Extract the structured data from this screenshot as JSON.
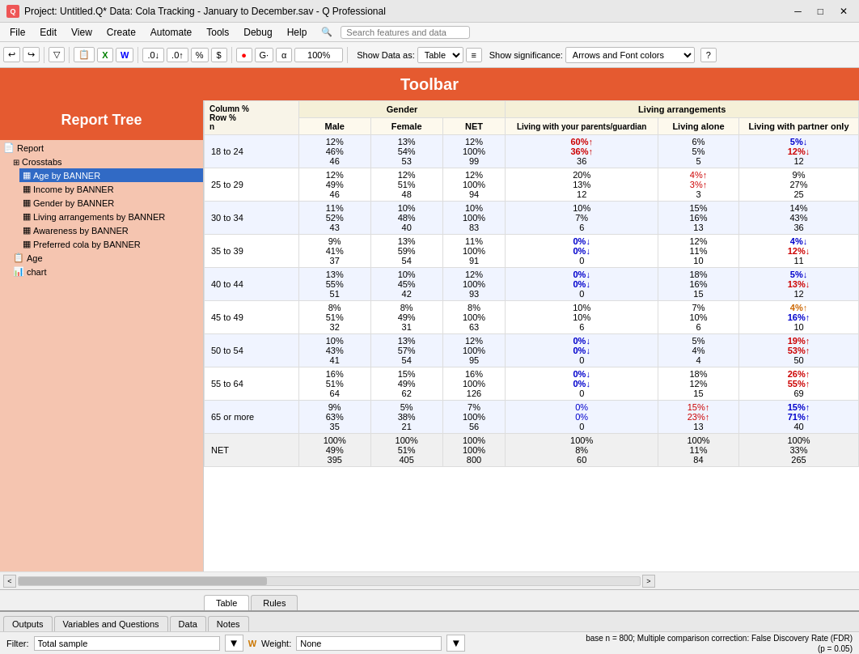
{
  "titleBar": {
    "title": "Project: Untitled.Q* Data: Cola Tracking - January to December.sav - Q Professional"
  },
  "menuBar": {
    "items": [
      "File",
      "Edit",
      "View",
      "Create",
      "Automate",
      "Tools",
      "Debug",
      "Help"
    ],
    "search": {
      "placeholder": "Search features and data"
    }
  },
  "toolbar": {
    "label": "Toolbar",
    "showDataAs": "Show Data as:",
    "tableLabel": "Table",
    "showSignificance": "Show significance:",
    "arrowsLabel": "Arrows and Font colors",
    "zoomLevel": "100%"
  },
  "reportTree": {
    "header": "Report Tree",
    "items": [
      {
        "label": "Report",
        "level": 0,
        "type": "report"
      },
      {
        "label": "Crosstabs",
        "level": 1,
        "type": "crosstabs"
      },
      {
        "label": "Age by BANNER",
        "level": 2,
        "type": "table",
        "selected": true
      },
      {
        "label": "Income by BANNER",
        "level": 2,
        "type": "table"
      },
      {
        "label": "Gender by BANNER",
        "level": 2,
        "type": "table"
      },
      {
        "label": "Living arrangements by BANNER",
        "level": 2,
        "type": "table"
      },
      {
        "label": "Awareness by BANNER",
        "level": 2,
        "type": "table"
      },
      {
        "label": "Preferred cola by BANNER",
        "level": 2,
        "type": "table"
      },
      {
        "label": "Age",
        "level": 1,
        "type": "report"
      },
      {
        "label": "chart",
        "level": 1,
        "type": "chart"
      }
    ]
  },
  "table": {
    "columnHeader1": "Column %",
    "columnHeader2": "Row %",
    "columnHeader3": "n",
    "genderGroup": "Gender",
    "livingGroup": "Living arrangements",
    "colMale": "Male",
    "colFemale": "Female",
    "colNET": "NET",
    "colLivingParents": "Living with your parents/guardian",
    "colLivingAlone": "Living alone",
    "colLivingPartner": "Living with partner only",
    "rows": [
      {
        "label": "18 to 24",
        "male": [
          "12%",
          "46%",
          "46"
        ],
        "female": [
          "13%",
          "54%",
          "53"
        ],
        "net": [
          "12%",
          "100%",
          "99"
        ],
        "parents": [
          "60%↑",
          "36%↑",
          "36"
        ],
        "alone": [
          "6%",
          "5%",
          "5"
        ],
        "partner": [
          "5%↓",
          "12%↓",
          "12"
        ],
        "parentColors": [
          "red-up",
          "red-up",
          ""
        ],
        "partnerColors": [
          "blue-down",
          "red-text",
          ""
        ]
      },
      {
        "label": "25 to 29",
        "male": [
          "12%",
          "49%",
          "46"
        ],
        "female": [
          "12%",
          "51%",
          "48"
        ],
        "net": [
          "12%",
          "100%",
          "94"
        ],
        "parents": [
          "20%",
          "13%",
          "12"
        ],
        "alone": [
          "4%↑",
          "3%↑",
          "3"
        ],
        "partner": [
          "9%",
          "27%",
          "25"
        ],
        "parentColors": [
          "",
          "",
          ""
        ],
        "partnerColors": [
          "",
          "",
          ""
        ]
      },
      {
        "label": "30 to 34",
        "male": [
          "11%",
          "52%",
          "43"
        ],
        "female": [
          "10%",
          "48%",
          "40"
        ],
        "net": [
          "10%",
          "100%",
          "83"
        ],
        "parents": [
          "10%",
          "7%",
          "6"
        ],
        "alone": [
          "15%",
          "16%",
          "13"
        ],
        "partner": [
          "14%",
          "43%",
          "36"
        ],
        "parentColors": [
          "",
          "",
          ""
        ],
        "partnerColors": [
          "",
          "",
          ""
        ]
      },
      {
        "label": "35 to 39",
        "male": [
          "9%",
          "41%",
          "37"
        ],
        "female": [
          "13%",
          "59%",
          "54"
        ],
        "net": [
          "11%",
          "100%",
          "91"
        ],
        "parents": [
          "0%↓",
          "0%↓",
          "0"
        ],
        "alone": [
          "12%",
          "11%",
          "10"
        ],
        "partner": [
          "4%↓",
          "12%↓",
          "11"
        ],
        "parentColors": [
          "blue-down",
          "blue-down",
          ""
        ],
        "partnerColors": [
          "blue-down",
          "red-text",
          ""
        ]
      },
      {
        "label": "40 to 44",
        "male": [
          "13%",
          "55%",
          "51"
        ],
        "female": [
          "10%",
          "45%",
          "42"
        ],
        "net": [
          "12%",
          "100%",
          "93"
        ],
        "parents": [
          "0%↓",
          "0%↓",
          "0"
        ],
        "alone": [
          "18%",
          "16%",
          "15"
        ],
        "partner": [
          "5%↓",
          "13%↓",
          "12"
        ],
        "parentColors": [
          "blue-down",
          "blue-down",
          ""
        ],
        "partnerColors": [
          "blue-down",
          "red-text",
          ""
        ]
      },
      {
        "label": "45 to 49",
        "male": [
          "8%",
          "51%",
          "32"
        ],
        "female": [
          "8%",
          "49%",
          "31"
        ],
        "net": [
          "8%",
          "100%",
          "63"
        ],
        "parents": [
          "10%",
          "10%",
          "6"
        ],
        "alone": [
          "7%",
          "10%",
          "6"
        ],
        "partner": [
          "4%↑",
          "16%↑",
          "10"
        ],
        "parentColors": [
          "",
          "",
          ""
        ],
        "partnerColors": [
          "orange-up",
          "blue-text",
          ""
        ]
      },
      {
        "label": "50 to 54",
        "male": [
          "10%",
          "43%",
          "41"
        ],
        "female": [
          "13%",
          "57%",
          "54"
        ],
        "net": [
          "12%",
          "100%",
          "95"
        ],
        "parents": [
          "0%↓",
          "0%↓",
          "0"
        ],
        "alone": [
          "5%",
          "4%",
          "4"
        ],
        "partner": [
          "19%↑",
          "53%↑",
          "50"
        ],
        "parentColors": [
          "blue-down",
          "blue-down",
          ""
        ],
        "partnerColors": [
          "red-up",
          "red-up",
          ""
        ]
      },
      {
        "label": "55 to 64",
        "male": [
          "16%",
          "51%",
          "64"
        ],
        "female": [
          "15%",
          "49%",
          "62"
        ],
        "net": [
          "16%",
          "100%",
          "126"
        ],
        "parents": [
          "0%↓",
          "0%↓",
          "0"
        ],
        "alone": [
          "18%",
          "12%",
          "15"
        ],
        "partner": [
          "26%↑",
          "55%↑",
          "69"
        ],
        "parentColors": [
          "blue-down",
          "blue-down",
          ""
        ],
        "partnerColors": [
          "red-up",
          "red-up",
          ""
        ]
      },
      {
        "label": "65 or more",
        "male": [
          "9%",
          "63%",
          "35"
        ],
        "female": [
          "5%",
          "38%",
          "21"
        ],
        "net": [
          "7%",
          "100%",
          "56"
        ],
        "parents": [
          "0%",
          "0%",
          "0"
        ],
        "alone": [
          "15%↑",
          "23%↑",
          "13"
        ],
        "partner": [
          "15%↑",
          "71%↑",
          "40"
        ],
        "parentColors": [
          "blue-text",
          "blue-text",
          ""
        ],
        "partnerColors": [
          "blue-text",
          "blue-text",
          ""
        ]
      },
      {
        "label": "NET",
        "male": [
          "100%",
          "49%",
          "395"
        ],
        "female": [
          "100%",
          "51%",
          "405"
        ],
        "net": [
          "100%",
          "100%",
          "800"
        ],
        "parents": [
          "100%",
          "8%",
          "60"
        ],
        "alone": [
          "100%",
          "11%",
          "84"
        ],
        "partner": [
          "100%",
          "33%",
          "265"
        ],
        "parentColors": [
          "",
          "",
          ""
        ],
        "partnerColors": [
          "",
          "",
          ""
        ]
      }
    ]
  },
  "innerTabs": {
    "table": "Table",
    "rules": "Rules"
  },
  "bottomTabs": {
    "outputs": "Outputs",
    "variablesAndQuestions": "Variables and Questions",
    "data": "Data",
    "notes": "Notes"
  },
  "statusBar": {
    "filterLabel": "Filter:",
    "filterValue": "Total sample",
    "weightLabel": "W",
    "weightText": "Weight:",
    "weightValue": "None",
    "statusText": "base n = 800; Multiple comparison correction: False Discovery Rate (FDR) (p = 0.05)"
  }
}
